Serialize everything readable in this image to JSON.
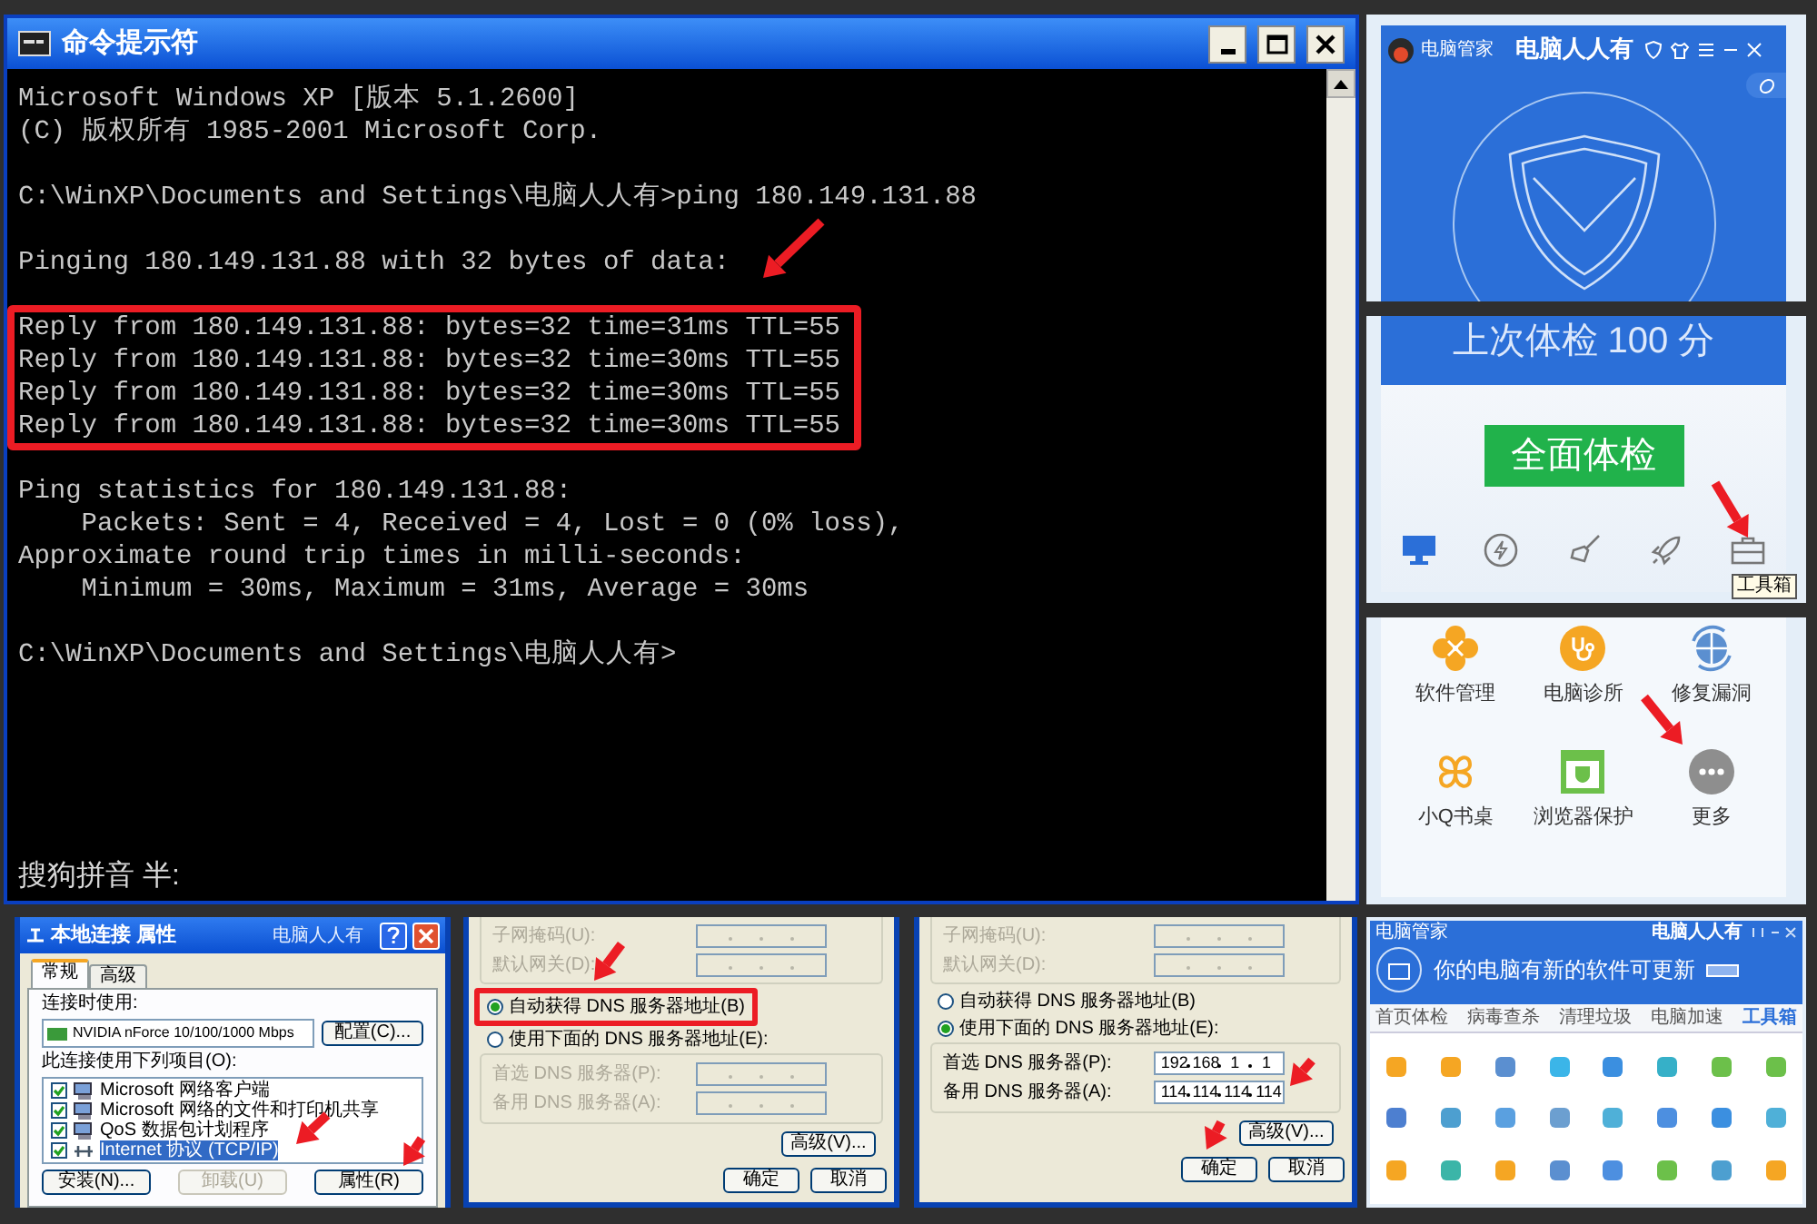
{
  "cmd_window": {
    "title": "命令提示符",
    "blocks": [
      {
        "highlighted": false,
        "lines": [
          "Microsoft Windows XP [版本 5.1.2600]",
          "(C) 版权所有 1985-2001 Microsoft Corp."
        ]
      },
      {
        "highlighted": false,
        "lines": [
          "C:\\WinXP\\Documents and Settings\\电脑人人有>ping 180.149.131.88"
        ]
      },
      {
        "highlighted": false,
        "lines": [
          "Pinging 180.149.131.88 with 32 bytes of data:"
        ]
      },
      {
        "highlighted": true,
        "lines": [
          "Reply from 180.149.131.88: bytes=32 time=31ms TTL=55",
          "Reply from 180.149.131.88: bytes=32 time=30ms TTL=55",
          "Reply from 180.149.131.88: bytes=32 time=30ms TTL=55",
          "Reply from 180.149.131.88: bytes=32 time=30ms TTL=55"
        ]
      },
      {
        "highlighted": false,
        "lines": [
          "Ping statistics for 180.149.131.88:",
          "    Packets: Sent = 4, Received = 4, Lost = 0 (0% loss),",
          "Approximate round trip times in milli-seconds:",
          "    Minimum = 30ms, Maximum = 31ms, Average = 30ms"
        ]
      },
      {
        "highlighted": false,
        "lines": [
          "C:\\WinXP\\Documents and Settings\\电脑人人有>"
        ]
      }
    ],
    "ime_status": "搜狗拼音 半:"
  },
  "pc_manager_home": {
    "app_name": "电脑管家",
    "caption": "电脑人人有"
  },
  "pc_manager_check": {
    "score_text": "上次体检 100 分",
    "check_button": "全面体检",
    "tooltip": "工具箱",
    "nav": [
      {
        "kind": "monitor",
        "selected": true
      },
      {
        "kind": "speed",
        "selected": false
      },
      {
        "kind": "broom",
        "selected": false
      },
      {
        "kind": "rocket",
        "selected": false
      },
      {
        "kind": "toolbox",
        "selected": false
      }
    ]
  },
  "pc_manager_tools": {
    "tools": [
      {
        "kind": "clover",
        "label": "软件管理"
      },
      {
        "kind": "stethoscope",
        "label": "电脑诊所"
      },
      {
        "kind": "repair",
        "label": "修复漏洞"
      },
      {
        "kind": "leaf",
        "label": "小Q书桌"
      },
      {
        "kind": "browser",
        "label": "浏览器保护"
      },
      {
        "kind": "more",
        "label": "更多"
      }
    ]
  },
  "pc_manager_toolbox": {
    "app_name": "电脑管家",
    "caption": "电脑人人有",
    "banner": "你的电脑有新的软件可更新",
    "tabs": [
      {
        "label": "首页体检",
        "selected": false
      },
      {
        "label": "病毒查杀",
        "selected": false
      },
      {
        "label": "清理垃圾",
        "selected": false
      },
      {
        "label": "电脑加速",
        "selected": false
      },
      {
        "label": "工具箱",
        "selected": true
      }
    ]
  },
  "connection_properties": {
    "title": "本地连接 属性",
    "caption": "电脑人人有",
    "tabs": [
      {
        "label": "常规",
        "selected": true
      },
      {
        "label": "高级",
        "selected": false
      }
    ],
    "connect_using_label": "连接时使用:",
    "adapter": "NVIDIA nForce 10/100/1000 Mbps",
    "configure_button": "配置(C)...",
    "items_label": "此连接使用下列项目(O):",
    "items": [
      {
        "kind": "client",
        "label": "Microsoft 网络客户端",
        "checked": true,
        "selected": false
      },
      {
        "kind": "client",
        "label": "Microsoft 网络的文件和打印机共享",
        "checked": true,
        "selected": false
      },
      {
        "kind": "client",
        "label": "QoS 数据包计划程序",
        "checked": true,
        "selected": false
      },
      {
        "kind": "protocol",
        "label": "Internet 协议 (TCP/IP)",
        "checked": true,
        "selected": true
      }
    ],
    "buttons": [
      {
        "label": "安装(N)...",
        "disabled": false
      },
      {
        "label": "卸载(U)",
        "disabled": true
      },
      {
        "label": "属性(R)",
        "disabled": false
      }
    ]
  },
  "dns_panels": [
    {
      "ip_fields": [
        {
          "label": "子网掩码(U):",
          "disabled": true
        },
        {
          "label": "默认网关(D):",
          "disabled": true
        }
      ],
      "radios": [
        {
          "label": "自动获得 DNS 服务器地址(B)",
          "selected": true,
          "highlighted": true
        },
        {
          "label": "使用下面的 DNS 服务器地址(E):",
          "selected": false,
          "highlighted": false
        }
      ],
      "dns_fields": [
        {
          "label": "首选 DNS 服务器(P):",
          "disabled": true
        },
        {
          "label": "备用 DNS 服务器(A):",
          "disabled": true
        }
      ],
      "advanced_button": "高级(V)...",
      "ok_button": "确定",
      "cancel_button": "取消"
    },
    {
      "ip_fields": [
        {
          "label": "子网掩码(U):",
          "disabled": true
        },
        {
          "label": "默认网关(D):",
          "disabled": true
        }
      ],
      "radios": [
        {
          "label": "自动获得 DNS 服务器地址(B)",
          "selected": false,
          "highlighted": false
        },
        {
          "label": "使用下面的 DNS 服务器地址(E):",
          "selected": true,
          "highlighted": false
        }
      ],
      "dns_fields": [
        {
          "label": "首选 DNS 服务器(P):",
          "disabled": false,
          "octets": [
            "192",
            "168",
            "1",
            "1"
          ]
        },
        {
          "label": "备用 DNS 服务器(A):",
          "disabled": false,
          "octets": [
            "114",
            "114",
            "114",
            "114"
          ]
        }
      ],
      "advanced_button": "高级(V)...",
      "ok_button": "确定",
      "cancel_button": "取消"
    }
  ]
}
